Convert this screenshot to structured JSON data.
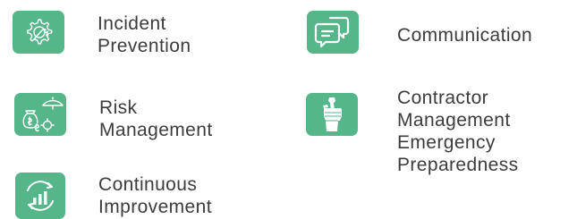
{
  "features": [
    {
      "icon": "gear-wrench-icon",
      "lines": [
        "Incident",
        "Prevention"
      ]
    },
    {
      "icon": "chat-bubbles-icon",
      "lines": [
        "Communication"
      ]
    },
    {
      "icon": "money-bag-umbrella-icon",
      "lines": [
        "Risk",
        "Management"
      ]
    },
    {
      "icon": "hand-wrench-icon",
      "lines": [
        "Contractor",
        "Management",
        "Emergency",
        "Preparedness"
      ]
    },
    {
      "icon": "growth-cycle-icon",
      "lines": [
        "Continuous",
        "Improvement"
      ]
    }
  ],
  "colors": {
    "tile": "#55b68a",
    "icon_stroke": "#ffffff",
    "text": "#3c3c3c"
  }
}
